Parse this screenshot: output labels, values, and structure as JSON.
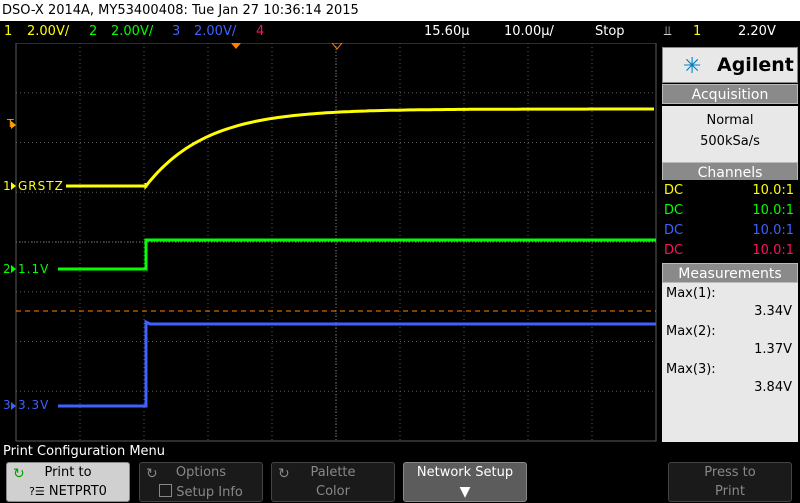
{
  "title": "DSO-X 2014A, MY53400408: Tue Jan 27 10:36:14 2015",
  "channels_bar": {
    "ch1_num": "1",
    "ch1_scale": "2.00V/",
    "ch2_num": "2",
    "ch2_scale": "2.00V/",
    "ch3_num": "3",
    "ch3_scale": "2.00V/",
    "ch4_num": "4",
    "delay": "15.60µ",
    "timebase": "10.00µ/",
    "run_state": "Stop",
    "trig_icon": "trigger-edge-icon",
    "trig_source": "1",
    "trig_level": "2.20V"
  },
  "screen": {
    "trigger_marker": "T",
    "ch1_label": "GRSTZ",
    "ch2_label": "1.1V",
    "ch3_label": "3.3V",
    "ch1_num": "1",
    "ch2_num": "2",
    "ch3_num": "3"
  },
  "side": {
    "brand": "Agilent",
    "acq_head": "Acquisition",
    "acq_mode": "Normal",
    "acq_rate": "500kSa/s",
    "chan_head": "Channels",
    "channels": [
      {
        "coupling": "DC",
        "probe": "10.0:1",
        "color": "#ffff00"
      },
      {
        "coupling": "DC",
        "probe": "10.0:1",
        "color": "#00ff00"
      },
      {
        "coupling": "DC",
        "probe": "10.0:1",
        "color": "#4060ff"
      },
      {
        "coupling": "DC",
        "probe": "10.0:1",
        "color": "#ff1060"
      }
    ],
    "meas_head": "Measurements",
    "meas": [
      {
        "label": "Max(1):",
        "value": "3.34V"
      },
      {
        "label": "Max(2):",
        "value": "1.37V"
      },
      {
        "label": "Max(3):",
        "value": "3.84V"
      }
    ]
  },
  "menu": {
    "title": "Print Configuration Menu",
    "print_to": "Print to",
    "print_to_value": "NETPRT0",
    "options": "Options",
    "setup_info": "Setup Info",
    "palette": "Palette",
    "palette_value": "Color",
    "network_setup": "Network Setup",
    "press_to": "Press to",
    "print": "Print"
  },
  "colors": {
    "ch1": "#ffff00",
    "ch2": "#00ff00",
    "ch3": "#4060ff",
    "ch4": "#ff1060",
    "trigger_level": "#ff8000",
    "grid": "#5a5a5a"
  }
}
